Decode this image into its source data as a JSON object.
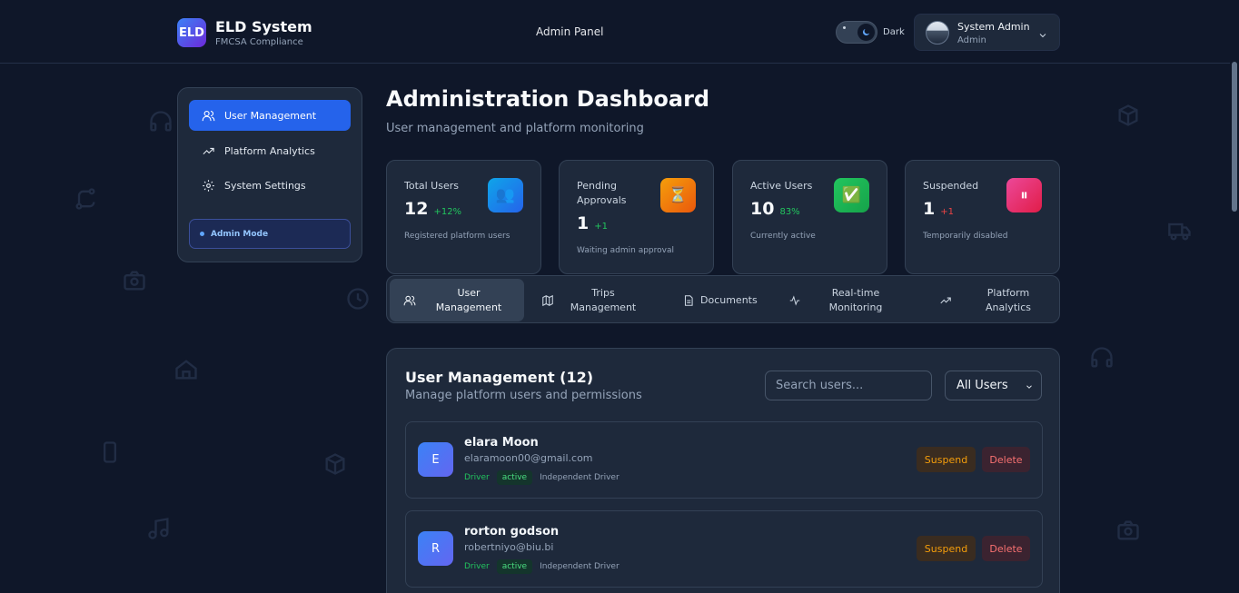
{
  "header": {
    "logo": "ELD",
    "brand_title": "ELD System",
    "brand_subtitle": "FMCSA Compliance",
    "center_label": "Admin Panel",
    "theme_label": "Dark",
    "user_name": "System Admin",
    "user_role": "Admin"
  },
  "sidebar": {
    "items": [
      {
        "label": "User Management",
        "icon": "users-icon",
        "active": true
      },
      {
        "label": "Platform Analytics",
        "icon": "trend-icon",
        "active": false
      },
      {
        "label": "System Settings",
        "icon": "gear-icon",
        "active": false
      }
    ],
    "mode_label": "Admin Mode"
  },
  "main": {
    "title": "Administration Dashboard",
    "subtitle": "User management and platform monitoring",
    "stats": [
      {
        "label": "Total Users",
        "value": "12",
        "delta": "+12%",
        "desc": "Registered platform users",
        "icon": "👥",
        "color": "#0ea5e9",
        "delta_color": "#22c55e"
      },
      {
        "label": "Pending Approvals",
        "value": "1",
        "delta": "+1",
        "desc": "Waiting admin approval",
        "icon": "⏳",
        "color": "#f97316",
        "delta_color": "#22c55e"
      },
      {
        "label": "Active Users",
        "value": "10",
        "delta": "83%",
        "desc": "Currently active",
        "icon": "✅",
        "color": "#22c55e",
        "delta_color": "#22c55e"
      },
      {
        "label": "Suspended",
        "value": "1",
        "delta": "+1",
        "desc": "Temporarily disabled",
        "icon": "⏸",
        "color": "#ec4899",
        "delta_color": "#ef4444"
      }
    ],
    "tabs": [
      {
        "label": "User Management",
        "icon": "users-icon",
        "active": true
      },
      {
        "label": "Trips Management",
        "icon": "map-icon",
        "active": false
      },
      {
        "label": "Documents",
        "icon": "document-icon",
        "active": false
      },
      {
        "label": "Real-time Monitoring",
        "icon": "activity-icon",
        "active": false
      },
      {
        "label": "Platform Analytics",
        "icon": "trend-icon",
        "active": false
      }
    ]
  },
  "user_panel": {
    "title": "User Management (12)",
    "subtitle": "Manage platform users and permissions",
    "search_placeholder": "Search users...",
    "filter_value": "All Users",
    "suspend_label": "Suspend",
    "delete_label": "Delete",
    "users": [
      {
        "initial": "E",
        "name": "elara Moon",
        "email": "elaramoon00@gmail.com",
        "role": "Driver",
        "status": "active",
        "type": "Independent Driver"
      },
      {
        "initial": "R",
        "name": "rorton godson",
        "email": "robertniyo@biu.bi",
        "role": "Driver",
        "status": "active",
        "type": "Independent Driver"
      }
    ]
  }
}
